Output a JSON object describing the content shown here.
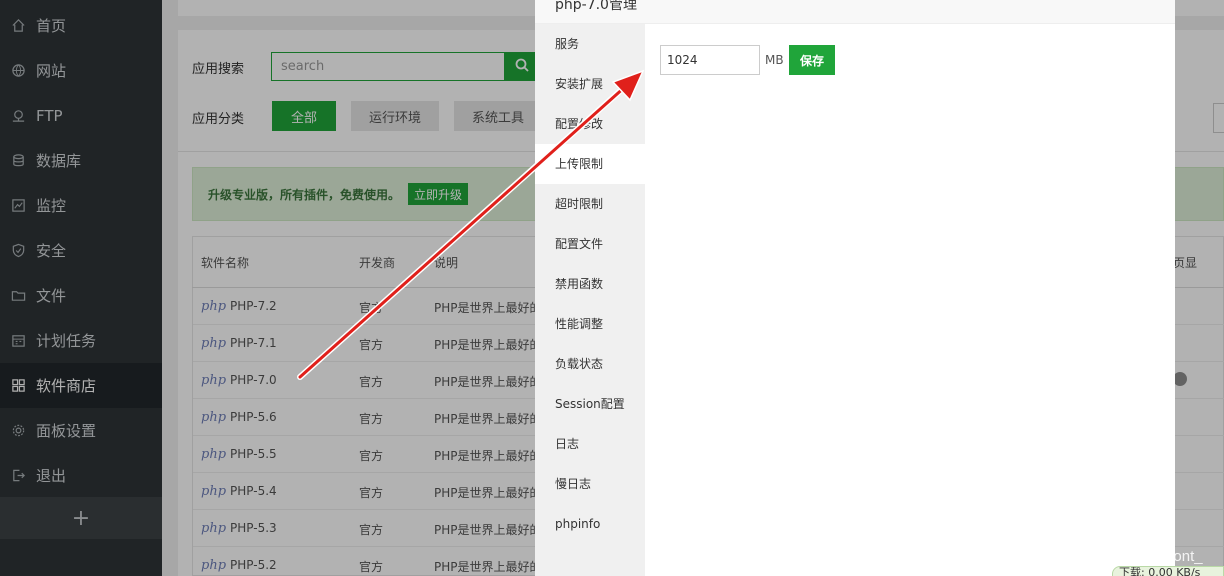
{
  "sidebar": {
    "items": [
      {
        "label": "首页",
        "icon": "home-icon"
      },
      {
        "label": "网站",
        "icon": "globe-icon"
      },
      {
        "label": "FTP",
        "icon": "ftp-icon"
      },
      {
        "label": "数据库",
        "icon": "database-icon"
      },
      {
        "label": "监控",
        "icon": "monitor-icon"
      },
      {
        "label": "安全",
        "icon": "shield-icon"
      },
      {
        "label": "文件",
        "icon": "folder-icon"
      },
      {
        "label": "计划任务",
        "icon": "calendar-icon"
      },
      {
        "label": "软件商店",
        "icon": "grid-icon",
        "active": true
      },
      {
        "label": "面板设置",
        "icon": "gear-icon"
      },
      {
        "label": "退出",
        "icon": "logout-icon"
      }
    ],
    "add_label": "+"
  },
  "store": {
    "search_label": "应用搜索",
    "search_placeholder": "search",
    "category_label": "应用分类",
    "categories": [
      "全部",
      "运行环境",
      "系统工具"
    ],
    "upgrade_text": "升级专业版，所有插件，免费使用。",
    "upgrade_button": "立即升级",
    "table_headers": {
      "name": "软件名称",
      "developer": "开发商",
      "desc": "说明",
      "display": "首页显示",
      "display_partial": "页显"
    },
    "rows": [
      {
        "name": "PHP-7.2",
        "developer": "官方",
        "desc": "PHP是世界上最好的"
      },
      {
        "name": "PHP-7.1",
        "developer": "官方",
        "desc": "PHP是世界上最好的"
      },
      {
        "name": "PHP-7.0",
        "developer": "官方",
        "desc": "PHP是世界上最好的"
      },
      {
        "name": "PHP-5.6",
        "developer": "官方",
        "desc": "PHP是世界上最好的"
      },
      {
        "name": "PHP-5.5",
        "developer": "官方",
        "desc": "PHP是世界上最好的"
      },
      {
        "name": "PHP-5.4",
        "developer": "官方",
        "desc": "PHP是世界上最好的"
      },
      {
        "name": "PHP-5.3",
        "developer": "官方",
        "desc": "PHP是世界上最好的"
      },
      {
        "name": "PHP-5.2",
        "developer": "官方",
        "desc": "PHP是世界上最好的"
      }
    ],
    "php_logo_text": "php"
  },
  "modal": {
    "title": "php-7.0管理",
    "menu": [
      "服务",
      "安装扩展",
      "配置修改",
      "上传限制",
      "超时限制",
      "配置文件",
      "禁用函数",
      "性能调整",
      "负载状态",
      "Session配置",
      "日志",
      "慢日志",
      "phpinfo"
    ],
    "active_menu": "上传限制",
    "upload_value": "1024",
    "unit": "MB",
    "save_label": "保存"
  },
  "watermark": "https://blog.csdn.net/Vermont_",
  "status_badge": "下载: 0.00 KB/s",
  "colors": {
    "accent": "#20a53a",
    "sidebar_bg": "#2f3437",
    "annotation": "#e0201b"
  }
}
